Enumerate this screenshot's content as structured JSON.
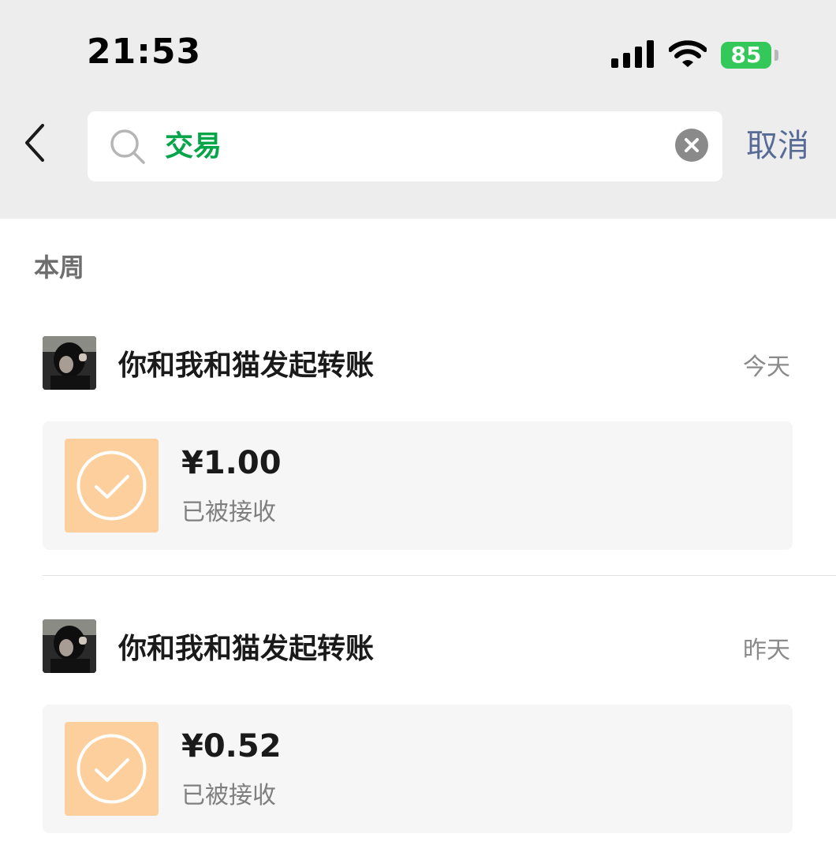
{
  "status_bar": {
    "time": "21:53",
    "battery": "85"
  },
  "search": {
    "query": "交易",
    "cancel_label": "取消"
  },
  "section": {
    "title": "本周"
  },
  "entries": [
    {
      "title": "你和我和猫发起转账",
      "date": "今天",
      "amount": "¥1.00",
      "status": "已被接收"
    },
    {
      "title": "你和我和猫发起转账",
      "date": "昨天",
      "amount": "¥0.52",
      "status": "已被接收"
    }
  ],
  "colors": {
    "accent_green": "#07a549",
    "link_blue": "#576b95",
    "transfer_orange": "#fdcf9c",
    "battery_green": "#34c759"
  },
  "icons": [
    "signal-icon",
    "wifi-icon",
    "battery-icon",
    "back-icon",
    "search-icon",
    "clear-icon",
    "check-icon"
  ]
}
